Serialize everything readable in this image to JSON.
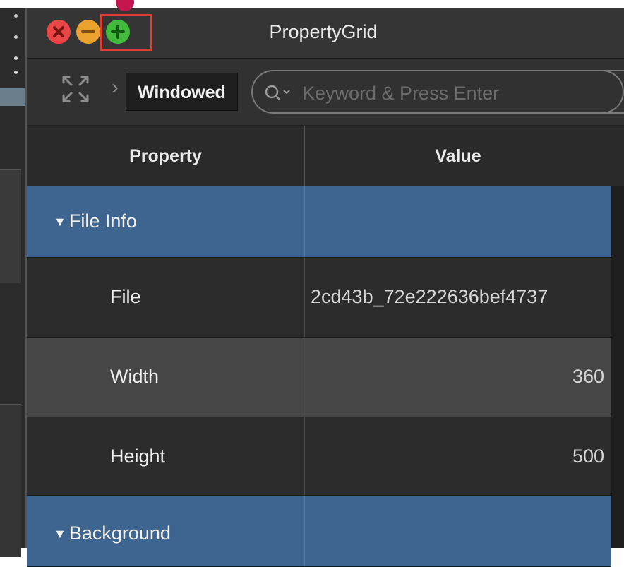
{
  "window": {
    "title": "PropertyGrid"
  },
  "titlebar": {
    "close_icon": "close-icon",
    "minimize_icon": "minimize-icon",
    "zoom_icon": "zoom-icon"
  },
  "toolbar": {
    "tooltip": "Windowed",
    "search": {
      "placeholder": "Keyword & Press Enter",
      "value": ""
    }
  },
  "table": {
    "headers": {
      "property": "Property",
      "value": "Value"
    },
    "rows": [
      {
        "type": "group",
        "name": "File Info"
      },
      {
        "type": "item",
        "name": "File",
        "value": "2cd43b_72e222636bef4737"
      },
      {
        "type": "item",
        "name": "Width",
        "value": "360"
      },
      {
        "type": "item",
        "name": "Height",
        "value": "500"
      },
      {
        "type": "group",
        "name": "Background"
      }
    ]
  },
  "colors": {
    "group_row": "#3d6590",
    "close": "#e94745",
    "minimize": "#eba12d",
    "zoom": "#43b93d",
    "highlight": "#e23d2e"
  }
}
